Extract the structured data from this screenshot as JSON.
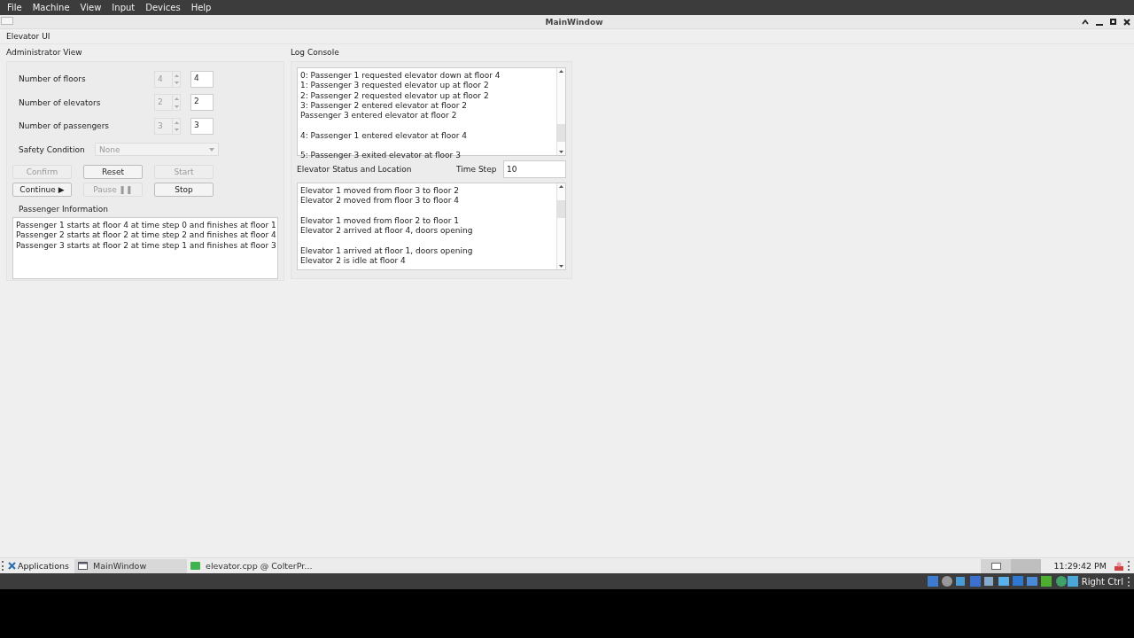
{
  "host_menu": [
    "File",
    "Machine",
    "View",
    "Input",
    "Devices",
    "Help"
  ],
  "window": {
    "title": "MainWindow"
  },
  "app_menu": "Elevator UI",
  "admin": {
    "title": "Administrator View",
    "fields": [
      {
        "label": "Number of floors",
        "spin_value": "4",
        "value": "4"
      },
      {
        "label": "Number of elevators",
        "spin_value": "2",
        "value": "2"
      },
      {
        "label": "Number of passengers",
        "spin_value": "3",
        "value": "3"
      }
    ],
    "safety": {
      "label": "Safety Condition",
      "value": "None",
      "disabled": true
    },
    "buttons": [
      {
        "label": "Confirm",
        "disabled": true
      },
      {
        "label": "Reset",
        "disabled": false
      },
      {
        "label": "Start",
        "disabled": true
      },
      {
        "label": "Continue ▶",
        "disabled": false
      },
      {
        "label": "Pause ❚❚",
        "disabled": true
      },
      {
        "label": "Stop",
        "disabled": false
      }
    ],
    "passenger_info": {
      "title": "Passenger Information",
      "lines": [
        "Passenger 1 starts at floor 4 at time step 0 and finishes at floor 1",
        "Passenger 2 starts at floor 2 at time step 2 and finishes at floor 4",
        "Passenger 3 starts at floor 2 at time step 1 and finishes at floor 3"
      ]
    }
  },
  "log": {
    "title": "Log Console",
    "blocks": [
      [
        "0: Passenger 1 requested elevator down at floor 4",
        "1: Passenger 3 requested elevator up at floor 2",
        "2: Passenger 2 requested elevator up at floor 2",
        "3: Passenger 2 entered elevator at floor 2",
        "Passenger 3 entered elevator at floor 2"
      ],
      [
        "4: Passenger 1 entered elevator at floor 4"
      ],
      [
        "5: Passenger 3 exited elevator at floor 3"
      ]
    ]
  },
  "status": {
    "title": "Elevator Status and Location",
    "time_step_label": "Time Step",
    "time_step_value": "10",
    "blocks": [
      [
        "Elevator 1 moved from floor 3 to floor 2",
        "Elevator 2 moved from floor 3 to floor 4"
      ],
      [
        "Elevator 1 moved from floor 2 to floor 1",
        "Elevator 2 arrived at floor 4, doors opening"
      ],
      [
        "Elevator 1 arrived at floor 1, doors opening",
        "Elevator 2 is idle at floor 4"
      ]
    ]
  },
  "taskbar": {
    "start": "Applications",
    "items": [
      {
        "label": "MainWindow",
        "selected": true
      },
      {
        "label": "elevator.cpp @ ColterPr...",
        "selected": false
      }
    ],
    "clock": "11:29:42 PM"
  },
  "host_status": {
    "key_label": "Right Ctrl"
  }
}
